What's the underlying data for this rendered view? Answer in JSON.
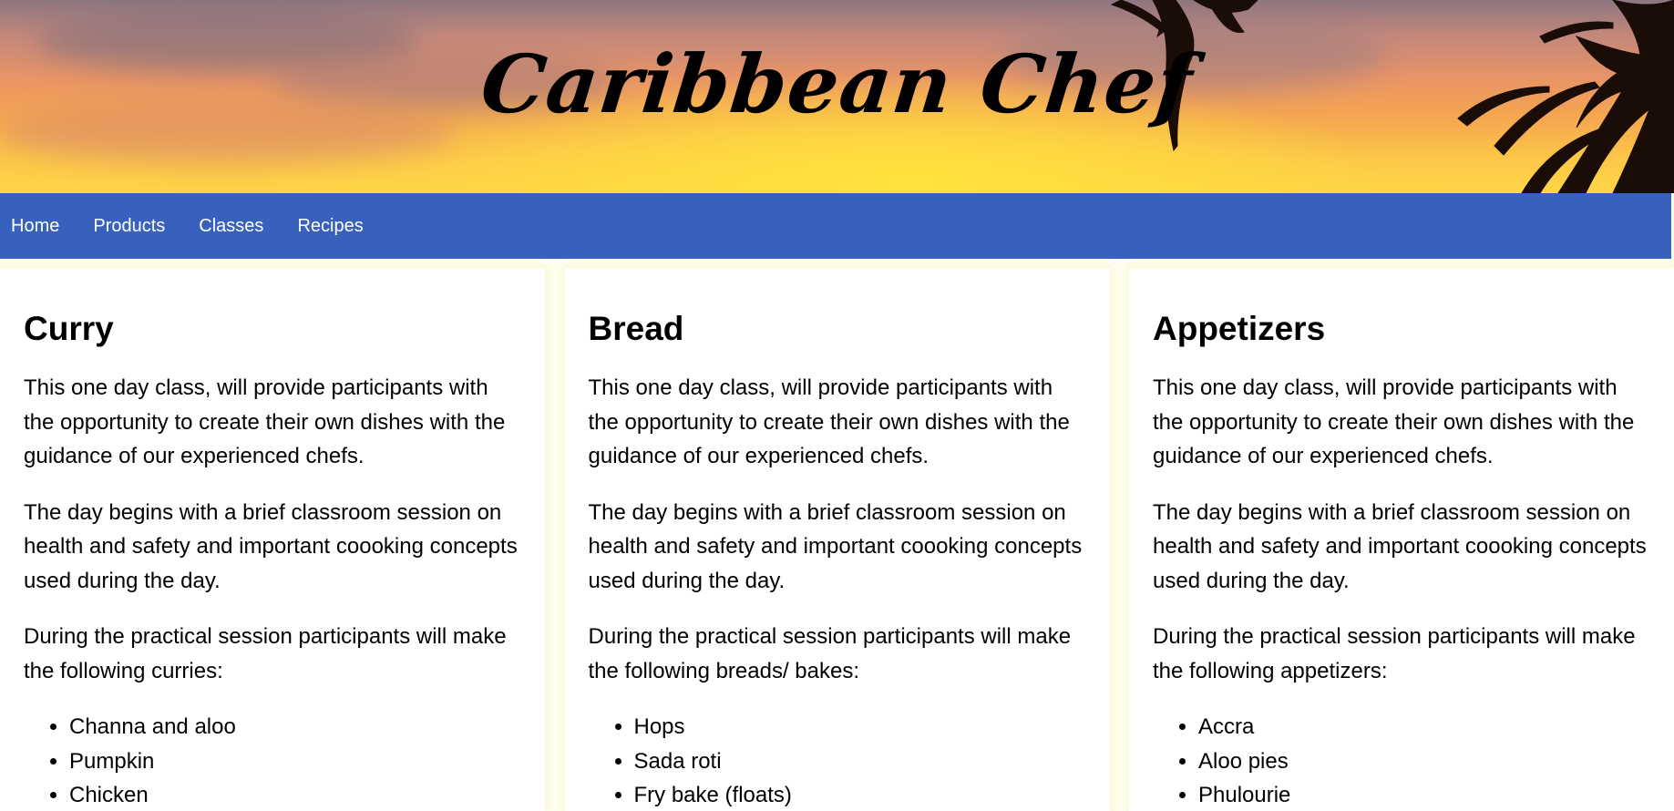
{
  "header": {
    "title": "Caribbean Chef"
  },
  "nav": {
    "items": [
      {
        "label": "Home"
      },
      {
        "label": "Products"
      },
      {
        "label": "Classes"
      },
      {
        "label": "Recipes"
      }
    ]
  },
  "colors": {
    "nav_background": "#3861bd",
    "nav_text": "#ffffff",
    "page_background": "#fffff0",
    "card_background": "#ffffff"
  },
  "classes": [
    {
      "heading": "Curry",
      "paragraphs": [
        "This one day class, will provide participants with the opportunity to create their own dishes with the guidance of our experienced chefs.",
        "The day begins with a brief classroom session on health and safety and important coooking concepts used during the day.",
        "During the practical session participants will make the following curries:"
      ],
      "items": [
        "Channa and aloo",
        "Pumpkin",
        "Chicken"
      ]
    },
    {
      "heading": "Bread",
      "paragraphs": [
        "This one day class, will provide participants with the opportunity to create their own dishes with the guidance of our experienced chefs.",
        "The day begins with a brief classroom session on health and safety and important coooking concepts used during the day.",
        "During the practical session participants will make the following breads/ bakes:"
      ],
      "items": [
        "Hops",
        "Sada roti",
        "Fry bake (floats)"
      ]
    },
    {
      "heading": "Appetizers",
      "paragraphs": [
        "This one day class, will provide participants with the opportunity to create their own dishes with the guidance of our experienced chefs.",
        "The day begins with a brief classroom session on health and safety and important coooking concepts used during the day.",
        "During the practical session participants will make the following appetizers:"
      ],
      "items": [
        "Accra",
        "Aloo pies",
        "Phulourie"
      ]
    }
  ]
}
